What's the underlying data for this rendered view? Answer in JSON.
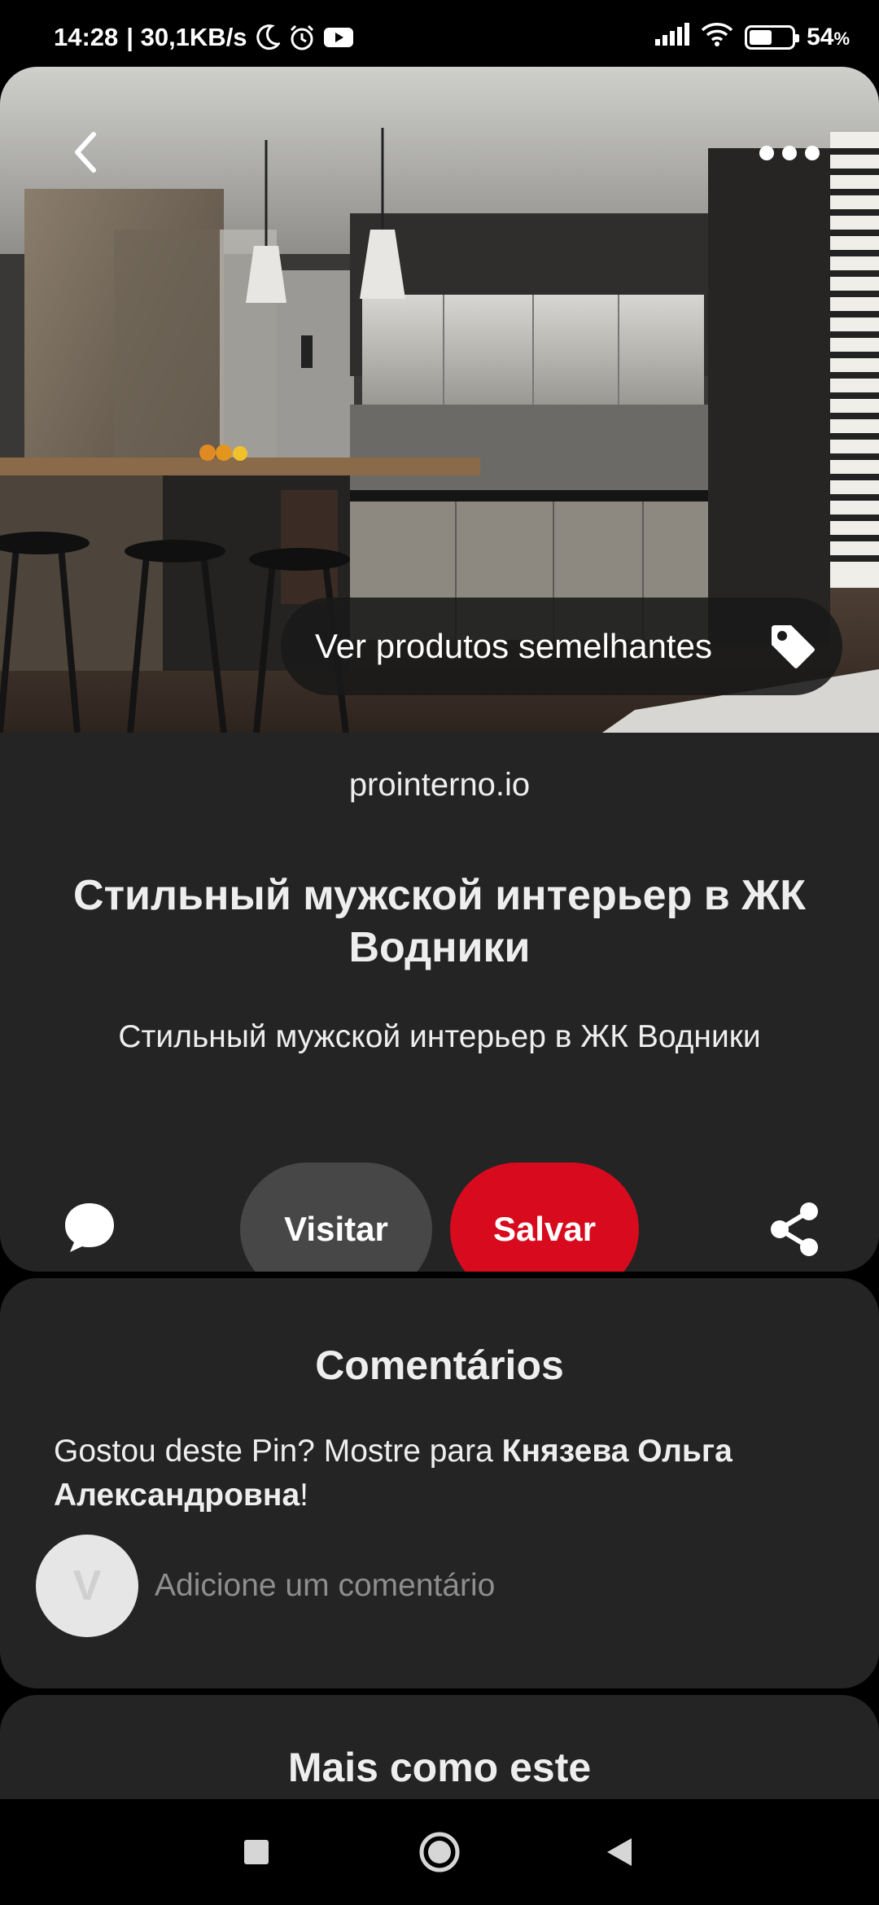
{
  "status_bar": {
    "time": "14:28",
    "network_speed": "| 30,1KB/s",
    "battery_percent": "54",
    "battery_unit": "%",
    "battery_level": 0.54,
    "icons": [
      "moon-icon",
      "alarm-icon",
      "youtube-icon",
      "signal-icon",
      "wifi-icon",
      "battery-icon"
    ]
  },
  "pin": {
    "back_icon": "chevron-left-icon",
    "more_icon": "more-horizontal-icon",
    "similar_products_label": "Ver produtos semelhantes",
    "similar_icon": "tag-icon",
    "source": "prointerno.io",
    "title": "Стильный мужской интерьер в ЖК Водники",
    "description": "Стильный мужской интерьер в ЖК Водники",
    "actions": {
      "comment_icon": "comment-bubble-icon",
      "visit_label": "Visitar",
      "save_label": "Salvar",
      "share_icon": "share-icon"
    }
  },
  "comments": {
    "title": "Comentários",
    "prompt_prefix": "Gostou deste Pin? Mostre para ",
    "prompt_name": "Князева Ольга Александровна",
    "prompt_suffix": "!",
    "avatar_initial": "V",
    "input_placeholder": "Adicione um comentário"
  },
  "more_like_this": {
    "title": "Mais como este"
  },
  "colors": {
    "background": "#000000",
    "card": "#242424",
    "save_red": "#d80a1e",
    "visit_gray": "#474747"
  },
  "navigation": {
    "icons": [
      "recent-apps-icon",
      "home-icon",
      "back-triangle-icon"
    ]
  }
}
